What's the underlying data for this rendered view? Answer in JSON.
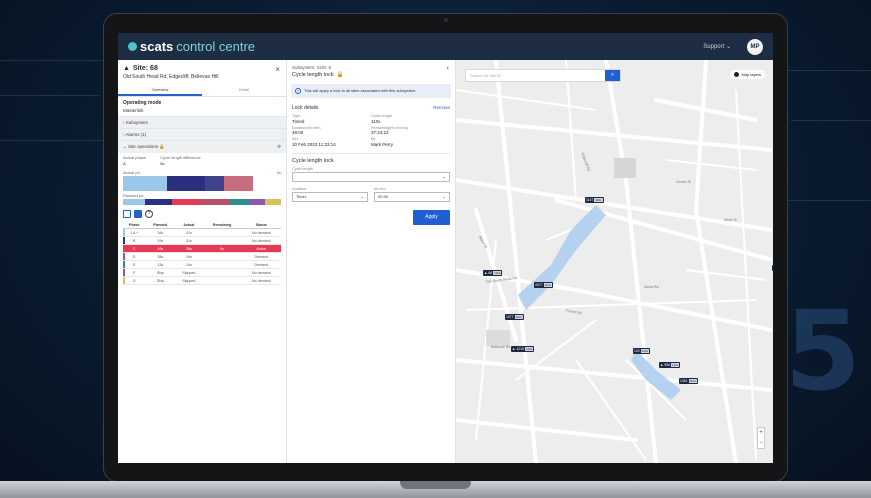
{
  "app": {
    "brand_bold": "scats",
    "brand_rest": "control centre",
    "support_label": "Support",
    "user_initials": "MP"
  },
  "site": {
    "title": "Site: 68",
    "address": "Old South Head Rd, Edgecliff, Bellevue Hill",
    "close_icon": "×",
    "tabs": [
      "Overview",
      "Detail"
    ],
    "operating_mode_label": "Operating mode",
    "operating_mode_value": "Masterlink",
    "accordions": [
      "Subsystem",
      "Alarms (1)"
    ],
    "site_operations_label": "Site operations",
    "actual_phase_label": "Actual phase",
    "actual_phase_value": "A",
    "cycle_diff_label": "Cycle length difference",
    "cycle_diff_value": "0s",
    "actual_ph_label": "Actual ph:",
    "actual_ph_note": "0s",
    "planned_ph_label": "Planned ph:",
    "table": {
      "headers": [
        "Phase",
        "Planned",
        "Actual",
        "Remaining",
        "Status"
      ],
      "rows": [
        {
          "phase": "1 A +",
          "planned": "16s",
          "actual": "41s",
          "remaining": "",
          "status": "No demand",
          "active": false,
          "color": "#9bc8e8"
        },
        {
          "phase": "B",
          "planned": "19s",
          "actual": "31s",
          "remaining": "",
          "status": "No demand",
          "active": false,
          "color": "#2a2f80"
        },
        {
          "phase": "C",
          "planned": "19s",
          "actual": "28s",
          "remaining": "0s",
          "status": "Active",
          "active": true,
          "color": "#e63955"
        },
        {
          "phase": "D",
          "planned": "35s",
          "actual": "19s",
          "remaining": "",
          "status": "Demand",
          "active": false,
          "color": "#b7506a"
        },
        {
          "phase": "E",
          "planned": "13s",
          "actual": "14s",
          "remaining": "",
          "status": "Demand",
          "active": false,
          "color": "#2f8f8c"
        },
        {
          "phase": "F",
          "planned": "Skip",
          "actual": "Skipped",
          "remaining": "",
          "status": "No demand",
          "active": false,
          "color": "#8a5aa8"
        },
        {
          "phase": "G",
          "planned": "Skip",
          "actual": "Skipped",
          "remaining": "",
          "status": "No demand",
          "active": false,
          "color": "#d8c15a"
        }
      ]
    }
  },
  "subsystem": {
    "sub": "Subsystem: XUS: 6",
    "title": "Cycle length lock",
    "info": "This will apply a lock to all sites associated with this subsystem.",
    "lock_details_label": "Lock details",
    "remove_label": "Remove",
    "details": [
      {
        "k": "Type",
        "v": "Timed"
      },
      {
        "k": "Cycle length",
        "v": "110s"
      },
      {
        "k": "Duration(hh:mm)",
        "v": "48:00"
      },
      {
        "k": "Remaining(hh:mm:ss)",
        "v": "37:24:23"
      },
      {
        "k": "Set",
        "v": "10 Feb 2023 11:33:14"
      },
      {
        "k": "By",
        "v": "Mark Perry"
      }
    ],
    "cl_lock_title": "Cycle length lock",
    "cl_field_label": "Cycle length",
    "duration_label": "Duration",
    "duration_value": "Timer",
    "hhmm_label": "hh:mm",
    "hhmm_value": "00:30",
    "apply_label": "Apply"
  },
  "map": {
    "search_placeholder": "Search for site ID",
    "layers_label": "Map layers",
    "streets": [
      "Old South Head Rd",
      "Ocean St",
      "Ethel St",
      "Forest Rd",
      "Edgecliff Rd",
      "Bellevue Rd",
      "Mona Rd",
      "Albert St"
    ],
    "tags": [
      {
        "id": "1147",
        "val": "110s"
      },
      {
        "id": "68",
        "val": "110s"
      },
      {
        "id": "4077",
        "val": "110s"
      },
      {
        "id": "1077",
        "val": "110s"
      },
      {
        "id": "1219",
        "val": "110s"
      },
      {
        "id": "122",
        "val": "110s"
      },
      {
        "id": "956",
        "val": "110s"
      },
      {
        "id": "1351",
        "val": "110s"
      },
      {
        "id": "2040",
        "val": "110s"
      },
      {
        "id": "3451",
        "val": "110s"
      }
    ]
  },
  "background_digit": "5"
}
